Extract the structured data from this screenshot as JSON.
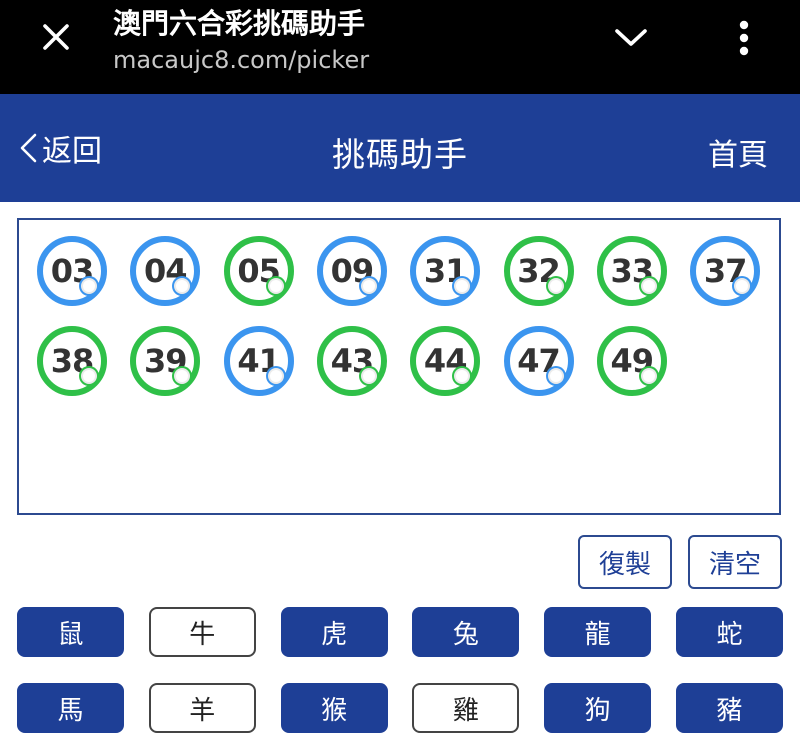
{
  "browser": {
    "title": "澳門六合彩挑碼助手",
    "url": "macaujc8.com/picker"
  },
  "header": {
    "back_label": "返回",
    "title": "挑碼助手",
    "home_label": "首頁",
    "color": "#1e3f96"
  },
  "picked_numbers": [
    {
      "num": "03",
      "color": "blue"
    },
    {
      "num": "04",
      "color": "blue"
    },
    {
      "num": "05",
      "color": "green"
    },
    {
      "num": "09",
      "color": "blue"
    },
    {
      "num": "31",
      "color": "blue"
    },
    {
      "num": "32",
      "color": "green"
    },
    {
      "num": "33",
      "color": "green"
    },
    {
      "num": "37",
      "color": "blue"
    },
    {
      "num": "38",
      "color": "green"
    },
    {
      "num": "39",
      "color": "green"
    },
    {
      "num": "41",
      "color": "blue"
    },
    {
      "num": "43",
      "color": "green"
    },
    {
      "num": "44",
      "color": "green"
    },
    {
      "num": "47",
      "color": "blue"
    },
    {
      "num": "49",
      "color": "green"
    }
  ],
  "ball_colors": {
    "blue": "#3b95ef",
    "green": "#2fc048"
  },
  "actions": {
    "copy_label": "復製",
    "clear_label": "清空"
  },
  "zodiac": [
    {
      "label": "鼠",
      "selected": true
    },
    {
      "label": "牛",
      "selected": false
    },
    {
      "label": "虎",
      "selected": true
    },
    {
      "label": "兔",
      "selected": true
    },
    {
      "label": "龍",
      "selected": true
    },
    {
      "label": "蛇",
      "selected": true
    },
    {
      "label": "馬",
      "selected": true
    },
    {
      "label": "羊",
      "selected": false
    },
    {
      "label": "猴",
      "selected": true
    },
    {
      "label": "雞",
      "selected": false
    },
    {
      "label": "狗",
      "selected": true
    },
    {
      "label": "豬",
      "selected": true
    }
  ],
  "icons": {
    "close": "close-icon",
    "collapse": "chevron-down-icon",
    "more": "more-vertical-icon",
    "back": "chevron-left-icon"
  }
}
